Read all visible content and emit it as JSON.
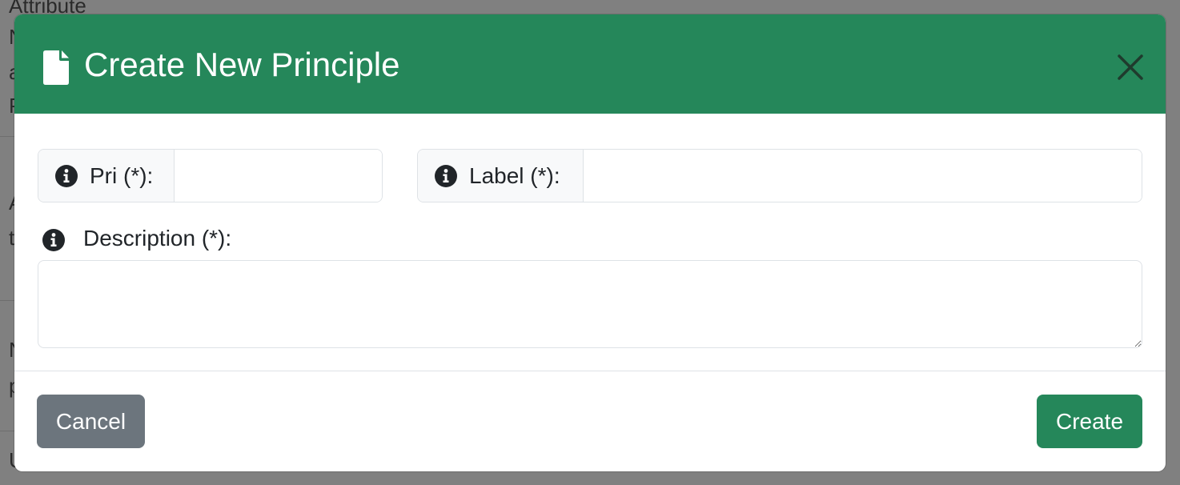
{
  "background": {
    "visible_fragments": [
      "Attribute",
      "N",
      "a",
      "P",
      "A",
      "t",
      "N",
      "p",
      "U"
    ]
  },
  "modal": {
    "title": "Create New Principle",
    "title_icon": "document-icon",
    "close_icon": "close-icon",
    "header_color": "#25875a",
    "fields": {
      "pri": {
        "label": "Pri (*):",
        "value": "",
        "icon": "info-icon"
      },
      "label": {
        "label": "Label (*):",
        "value": "",
        "icon": "info-icon"
      },
      "description": {
        "label": "Description (*):",
        "value": "",
        "icon": "info-icon"
      }
    },
    "buttons": {
      "cancel_label": "Cancel",
      "create_label": "Create"
    },
    "colors": {
      "primary": "#25875a",
      "secondary": "#6c757d"
    }
  }
}
